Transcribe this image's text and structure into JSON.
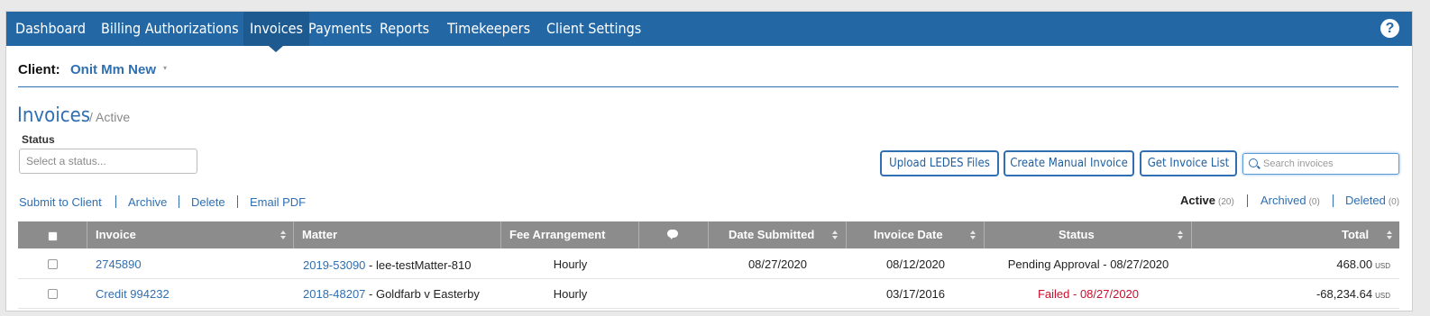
{
  "nav": {
    "items": [
      {
        "label": "Dashboard"
      },
      {
        "label": "Billing Authorizations"
      },
      {
        "label": "Invoices"
      },
      {
        "label": "Payments"
      },
      {
        "label": "Reports"
      },
      {
        "label": "Timekeepers"
      },
      {
        "label": "Client Settings"
      }
    ],
    "active": "Invoices",
    "help_glyph": "?"
  },
  "client": {
    "label": "Client:",
    "name": "Onit Mm New",
    "caret": "▾"
  },
  "page": {
    "title": "Invoices",
    "subtitle": "/ Active"
  },
  "status_filter": {
    "label": "Status",
    "placeholder": "Select a status..."
  },
  "buttons": {
    "upload": "Upload LEDES Files",
    "create": "Create Manual Invoice",
    "get_list": "Get Invoice List"
  },
  "search": {
    "placeholder": "Search invoices"
  },
  "actions": [
    "Submit to Client",
    "Archive",
    "Delete",
    "Email PDF"
  ],
  "filters": [
    {
      "label": "Active",
      "count": "(20)",
      "selected": true
    },
    {
      "label": "Archived",
      "count": "(0)",
      "selected": false
    },
    {
      "label": "Deleted",
      "count": "(0)",
      "selected": false
    }
  ],
  "table": {
    "columns": [
      "Invoice",
      "Matter",
      "Fee Arrangement",
      "",
      "Date Submitted",
      "Invoice Date",
      "Status",
      "Total"
    ],
    "rows": [
      {
        "invoice": "2745890",
        "matter_id": "2019-53090",
        "matter_name": " - lee-testMatter-810",
        "fee": "Hourly",
        "date_submitted": "08/27/2020",
        "invoice_date": "08/12/2020",
        "status": "Pending Approval - 08/27/2020",
        "status_type": "pending",
        "total": "468.00",
        "currency": "USD"
      },
      {
        "invoice": "Credit 994232",
        "matter_id": "2018-48207",
        "matter_name": " - Goldfarb v Easterby",
        "fee": "Hourly",
        "date_submitted": "",
        "invoice_date": "03/17/2016",
        "status": "Failed - 08/27/2020",
        "status_type": "failed",
        "total": "-68,234.64",
        "currency": "USD"
      }
    ]
  },
  "colors": {
    "nav_bg": "#2368a5",
    "accent": "#2f6fb2",
    "header_bg": "#8c8c8c",
    "failed": "#c8102e"
  }
}
